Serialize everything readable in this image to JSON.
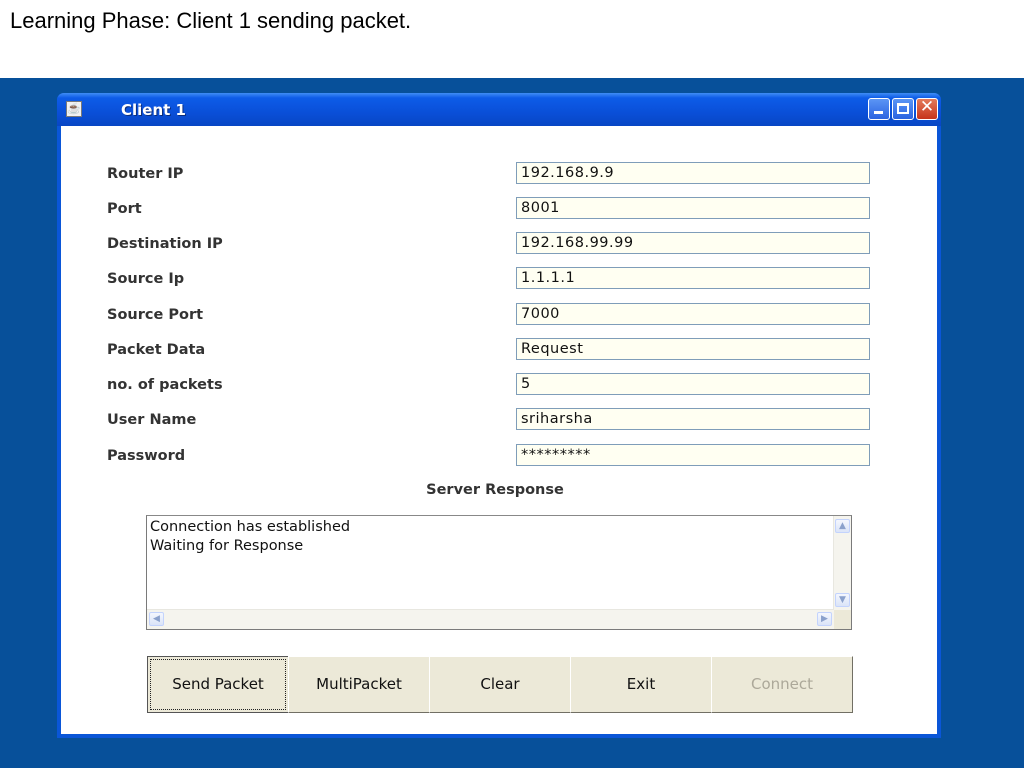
{
  "slide": {
    "caption": "Learning Phase: Client 1 sending packet."
  },
  "window": {
    "title": "Client 1",
    "icons": {
      "app": "java-cup-icon",
      "minimize": "minimize-icon",
      "maximize": "maximize-icon",
      "close": "close-icon"
    }
  },
  "form": {
    "fields": [
      {
        "label": "Router IP",
        "value": "192.168.9.9"
      },
      {
        "label": "Port",
        "value": "8001"
      },
      {
        "label": "Destination IP",
        "value": "192.168.99.99"
      },
      {
        "label": "Source Ip",
        "value": "1.1.1.1"
      },
      {
        "label": "Source Port",
        "value": "7000"
      },
      {
        "label": "Packet Data",
        "value": "Request"
      },
      {
        "label": "no. of packets",
        "value": "5"
      },
      {
        "label": "User Name",
        "value": "sriharsha"
      },
      {
        "label": "Password",
        "value": "*********"
      }
    ]
  },
  "server_response": {
    "label": "Server Response",
    "text": "Connection has established\nWaiting for Response"
  },
  "buttons": {
    "send_packet": "Send Packet",
    "multi_packet": "MultiPacket",
    "clear": "Clear",
    "exit": "Exit",
    "connect": "Connect"
  },
  "colors": {
    "slide_background": "#07509a",
    "titlebar": "#0a4fd8",
    "button_face": "#ece9d8",
    "input_background": "#fffff2",
    "disabled_text": "#aca899"
  }
}
